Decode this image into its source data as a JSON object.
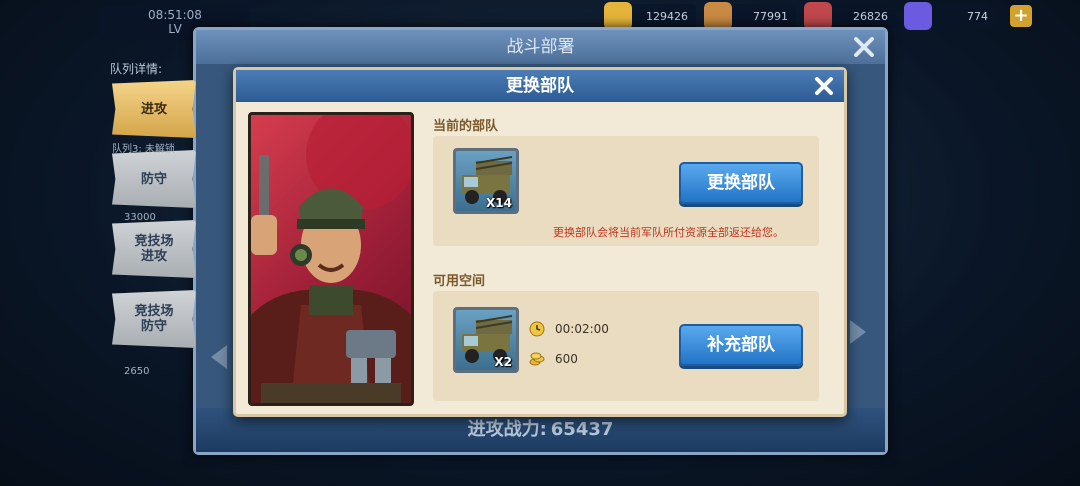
{
  "top_bar": {
    "resources": [
      {
        "name": "gold",
        "value": "129426",
        "color": "#e5b53a"
      },
      {
        "name": "food",
        "value": "77991",
        "color": "#c98a43"
      },
      {
        "name": "ammo",
        "value": "26826",
        "color": "#c0484c"
      },
      {
        "name": "gem",
        "value": "774",
        "color": "#6a5be0"
      }
    ],
    "top_left_value": "08:51:08",
    "top_left_sub": "LV"
  },
  "outer_panel": {
    "title": "战斗部署",
    "queue_title": "队列详情:",
    "tabs": [
      {
        "label": "进攻",
        "active": true
      },
      {
        "label": "防守",
        "active": false
      },
      {
        "label": "竞技场\n进攻",
        "active": false
      },
      {
        "label": "竞技场\n防守",
        "active": false
      }
    ],
    "notes": [
      "队列3: 未解锁",
      "33000",
      "2650"
    ],
    "footer_label": "进攻战力:",
    "footer_value": "65437"
  },
  "modal": {
    "title": "更换部队",
    "current_section": {
      "label": "当前的部队",
      "unit_count": "X14",
      "button": "更换部队",
      "warning": "更换部队会将当前军队所付资源全部返还给您。"
    },
    "available_section": {
      "label": "可用空间",
      "unit_count": "X2",
      "time": "00:02:00",
      "cost": "600",
      "button": "补充部队"
    }
  },
  "colors": {
    "modal_header": "#2c5b94",
    "button_blue": "#2274c6",
    "warning_red": "#c0341d",
    "parchment": "#f2e9d7"
  }
}
